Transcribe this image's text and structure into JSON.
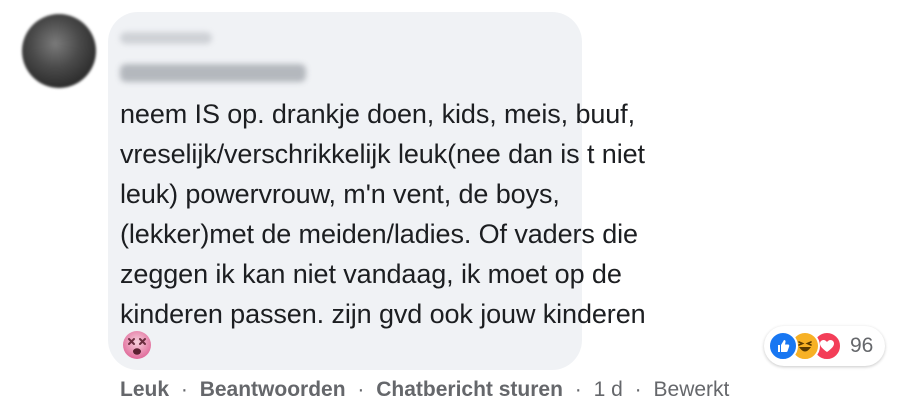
{
  "comment": {
    "lines": [
      "neem IS op. drankje doen, kids, meis, buuf,",
      "vreselijk/verschrikkelijk leuk(nee dan is t niet",
      "leuk) powervrouw, m'n vent, de boys,",
      "(lekker)met de meiden/ladies. Of vaders die",
      "zeggen ik kan niet vandaag, ik moet op de",
      "kinderen passen. zijn gvd ook jouw kinderen"
    ],
    "trailing_emoji": "dizzy-face-emoji"
  },
  "reactions": {
    "icons": [
      "like-icon",
      "haha-icon",
      "love-icon"
    ],
    "count": "96"
  },
  "actions": {
    "like": "Leuk",
    "reply": "Beantwoorden",
    "message": "Chatbericht sturen",
    "time": "1 d",
    "edited": "Bewerkt",
    "separator": "·"
  },
  "colors": {
    "bubble": "#f0f2f5",
    "text": "#1c1e21",
    "meta": "#65676b",
    "like": "#1877f2",
    "haha": "#f7b125",
    "love": "#f33e58"
  }
}
